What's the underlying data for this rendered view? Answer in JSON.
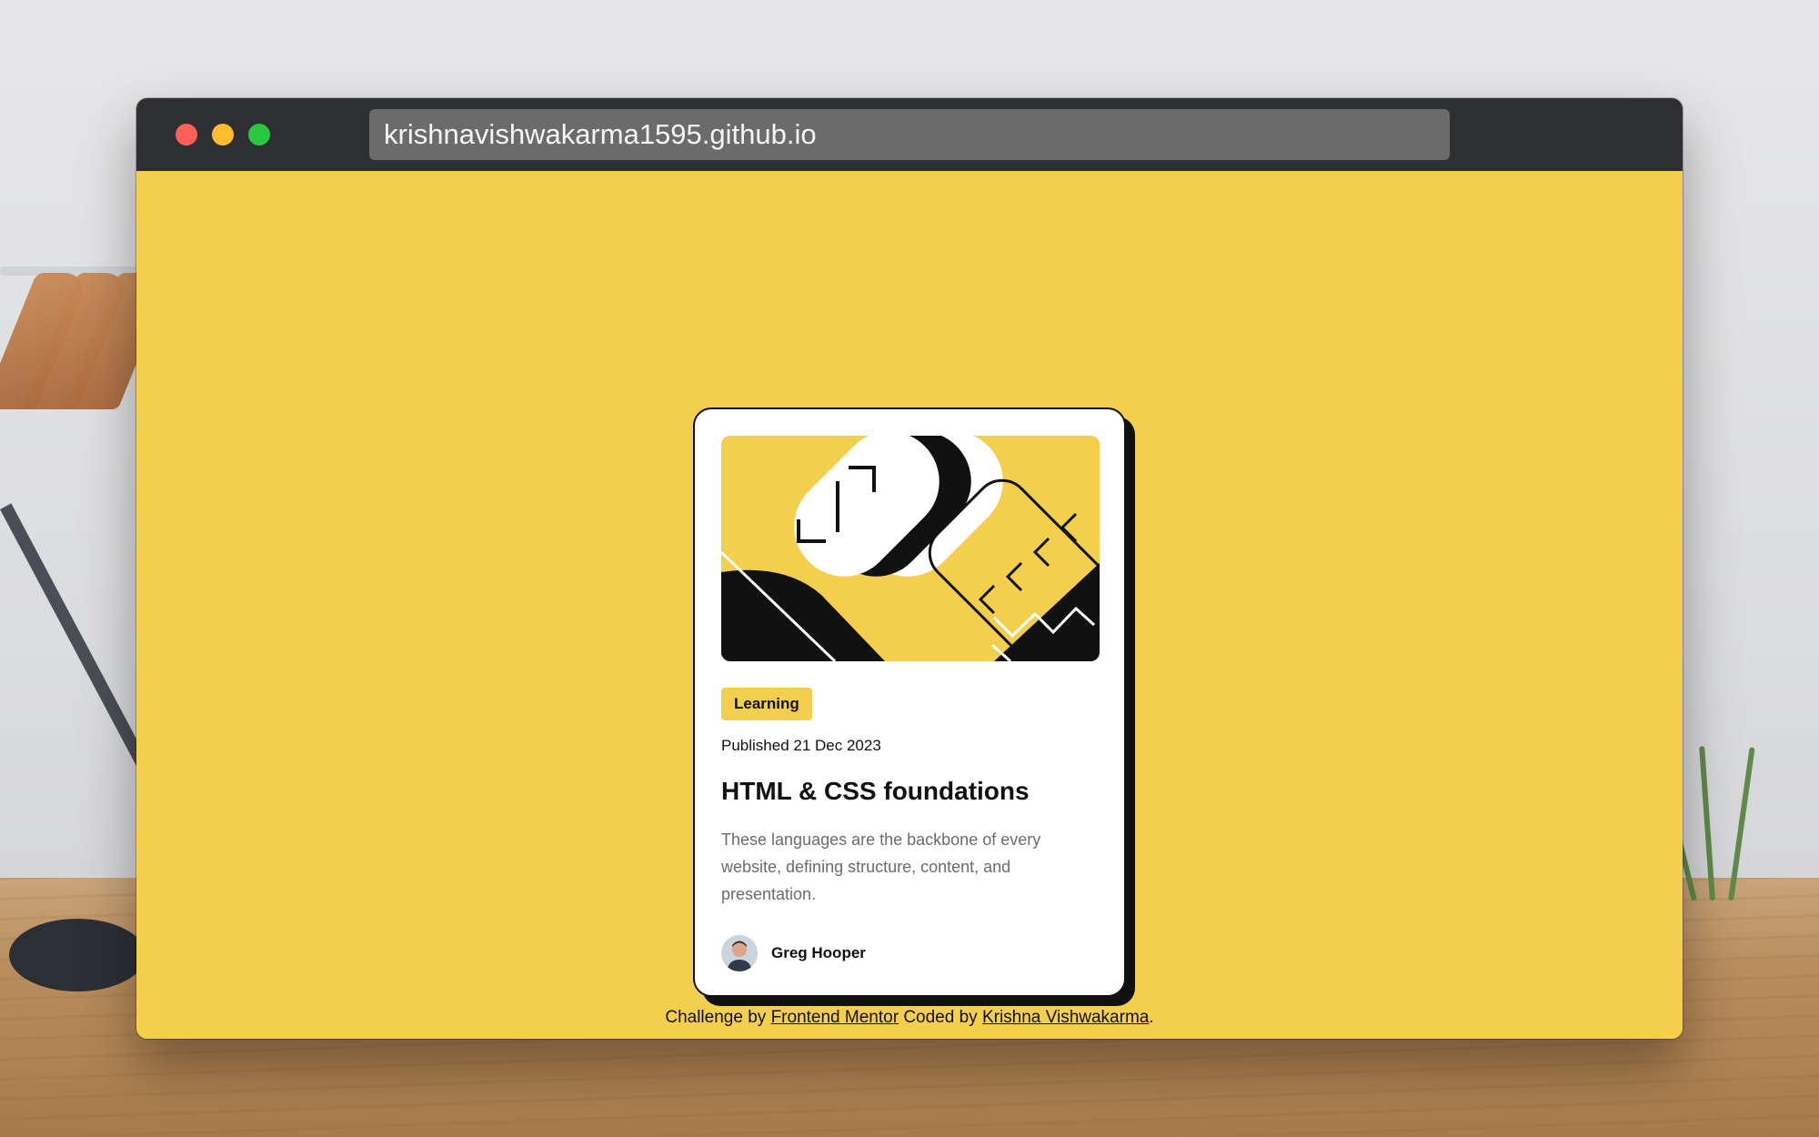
{
  "browser": {
    "url": "krishnavishwakarma1595.github.io"
  },
  "card": {
    "tag": "Learning",
    "published": "Published 21 Dec 2023",
    "title": "HTML & CSS foundations",
    "description": "These languages are the backbone of every website, defining structure, content, and presentation.",
    "author": "Greg Hooper"
  },
  "footer": {
    "prefix": "Challenge by",
    "mentor_link": "Frontend Mentor",
    "middle": "Coded by",
    "coder_link": "Krishna Vishwakarma",
    "suffix": "."
  },
  "colors": {
    "background": "#f4cf4d",
    "card": "#ffffff",
    "ink": "#111111",
    "muted_text": "#6b6b6b",
    "titlebar": "#2e2f32",
    "urlbar": "#6b6b6b",
    "close_dot": "#fe5f57",
    "minimize_dot": "#febc2e",
    "maximize_dot": "#28c840"
  },
  "icons": {
    "close": "close-dot-icon",
    "minimize": "minimize-dot-icon",
    "maximize": "maximize-dot-icon"
  }
}
